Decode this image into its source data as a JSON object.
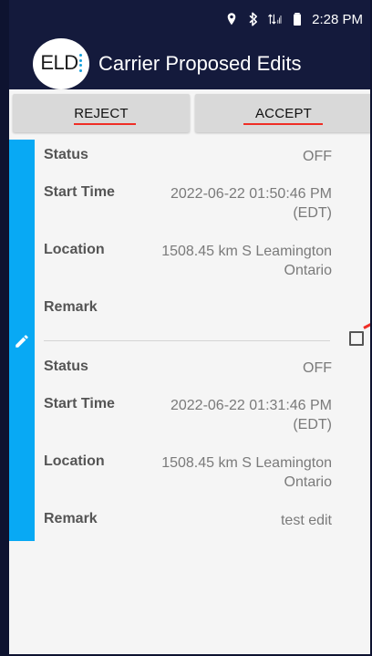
{
  "status_bar": {
    "time": "2:28 PM",
    "icons": [
      "location-icon",
      "bluetooth-icon",
      "signal-icon",
      "battery-icon"
    ]
  },
  "app_bar": {
    "logo_text": "ELD",
    "title": "Carrier Proposed Edits"
  },
  "actions": {
    "reject_label": "REJECT",
    "accept_label": "ACCEPT"
  },
  "records": [
    {
      "status_label": "Status",
      "status_value": "OFF",
      "start_time_label": "Start Time",
      "start_time_value": "2022-06-22 01:50:46 PM (EDT)",
      "location_label": "Location",
      "location_value": "1508.45 km S Leamington Ontario",
      "remark_label": "Remark",
      "remark_value": ""
    },
    {
      "status_label": "Status",
      "status_value": "OFF",
      "start_time_label": "Start Time",
      "start_time_value": "2022-06-22 01:31:46 PM (EDT)",
      "location_label": "Location",
      "location_value": "1508.45 km S Leamington Ontario",
      "remark_label": "Remark",
      "remark_value": "test edit"
    }
  ],
  "colors": {
    "app_bar": "#141a3c",
    "edit_bar": "#08a9f4",
    "annotation": "#ef2e26",
    "button": "#d9d9d9",
    "content_bg": "#f5f5f5"
  }
}
